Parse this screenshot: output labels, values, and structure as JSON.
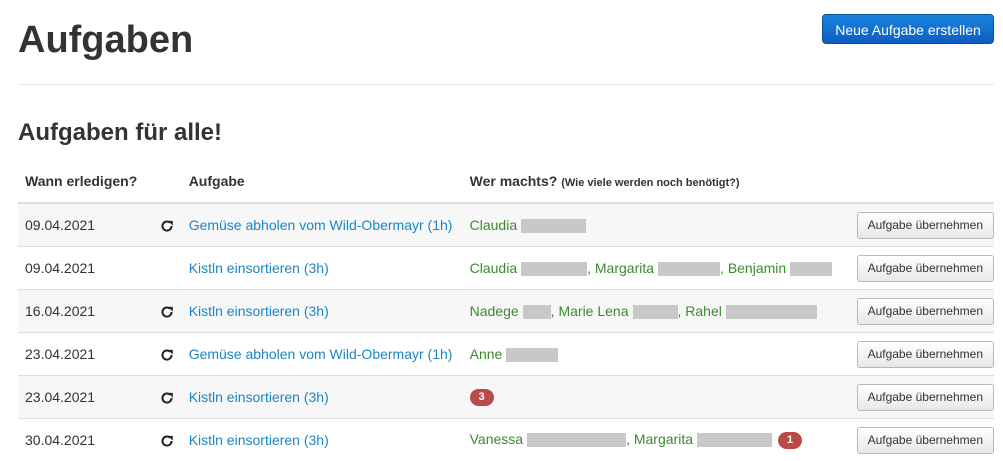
{
  "header": {
    "title": "Aufgaben",
    "create_button": "Neue Aufgabe erstellen"
  },
  "section": {
    "title": "Aufgaben für alle!"
  },
  "table": {
    "columns": {
      "when": "Wann erledigen?",
      "task": "Aufgabe",
      "who": "Wer machts?",
      "who_hint": "(Wie viele werden noch benötigt?)"
    },
    "rows": [
      {
        "date": "09.04.2021",
        "recurring": true,
        "task": "Gemüse abholen vom Wild-Obermayr (1h)",
        "people": [
          {
            "name": "Claudia"
          }
        ],
        "needed": "",
        "action": "Aufgabe übernehmen"
      },
      {
        "date": "09.04.2021",
        "recurring": false,
        "task": "Kistln einsortieren (3h)",
        "people": [
          {
            "name": "Claudia"
          },
          {
            "name": "Margarita"
          },
          {
            "name": "Benjamin"
          }
        ],
        "needed": "",
        "action": "Aufgabe übernehmen"
      },
      {
        "date": "16.04.2021",
        "recurring": true,
        "task": "Kistln einsortieren (3h)",
        "people": [
          {
            "name": "Nadege"
          },
          {
            "name": "Marie Lena"
          },
          {
            "name": "Rahel"
          }
        ],
        "needed": "",
        "action": "Aufgabe übernehmen"
      },
      {
        "date": "23.04.2021",
        "recurring": true,
        "task": "Gemüse abholen vom Wild-Obermayr (1h)",
        "people": [
          {
            "name": "Anne"
          }
        ],
        "needed": "",
        "action": "Aufgabe übernehmen"
      },
      {
        "date": "23.04.2021",
        "recurring": true,
        "task": "Kistln einsortieren (3h)",
        "people": [],
        "needed": "3",
        "action": "Aufgabe übernehmen"
      },
      {
        "date": "30.04.2021",
        "recurring": true,
        "task": "Kistln einsortieren (3h)",
        "people": [
          {
            "name": "Vanessa"
          },
          {
            "name": "Margarita"
          }
        ],
        "needed": "1",
        "action": "Aufgabe übernehmen"
      }
    ]
  },
  "icons": {
    "recurring": "refresh-icon"
  },
  "colors": {
    "primary_button": "#0e5ec0",
    "link": "#1a85c7",
    "assignee": "#3c8a2e",
    "badge": "#b94a48",
    "redaction": "#c8c8c8"
  }
}
